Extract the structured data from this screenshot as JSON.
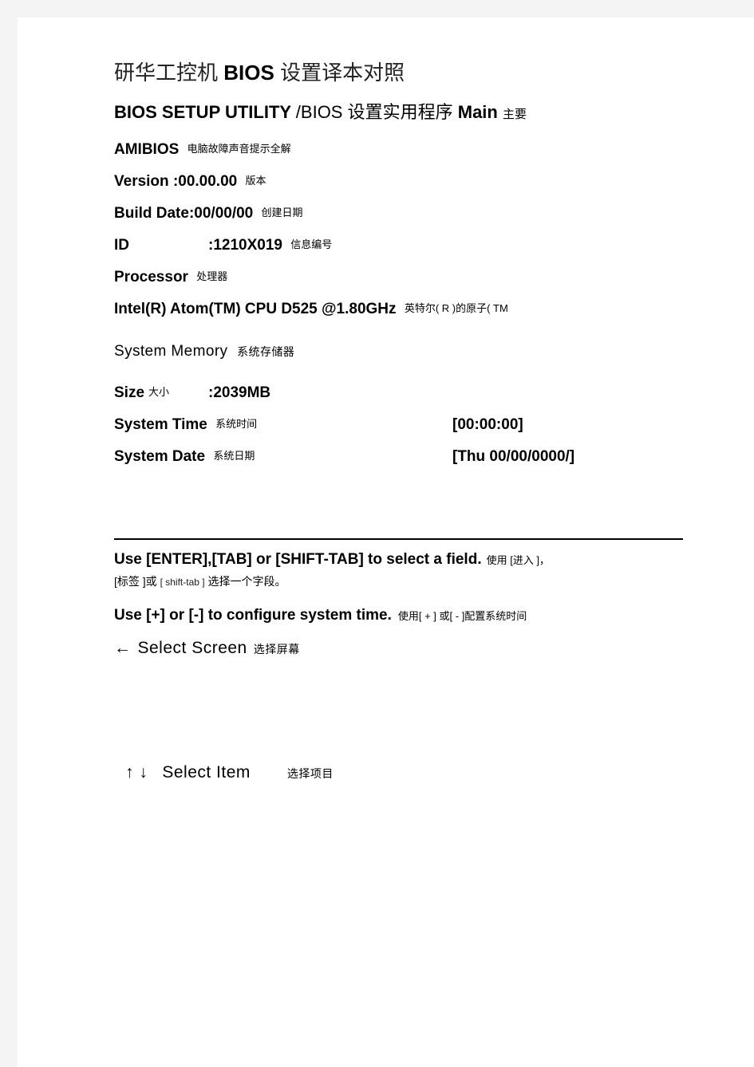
{
  "document": {
    "title_cn": "研华工控机",
    "title_en": "BIOS",
    "title_cn_tail": "设置译本对照"
  },
  "utility_header": {
    "en": "BIOS SETUP UTILITY",
    "separator": "/BIOS",
    "cn": "设置实用程序",
    "tab": "Main",
    "tab_cn": "主要"
  },
  "info": {
    "amibios": {
      "label": "AMIBIOS",
      "cn": "电脑故障声音提示全解"
    },
    "version": {
      "label": "Version",
      "value": ":00.00.00",
      "cn": "版本"
    },
    "build_date": {
      "label": "Build Date",
      "value": ":00/00/00",
      "cn": "创建日期"
    },
    "id": {
      "label": "ID",
      "value": ":1210X019",
      "cn": "信息编号"
    },
    "processor": {
      "label": "Processor",
      "cn": "处理器"
    },
    "cpu": {
      "label": "Intel(R) Atom(TM) CPU D525 @1.80GHz",
      "cn": "英特尔( R )的原子( TM"
    }
  },
  "system_memory": {
    "label": "System Memory",
    "cn": "系统存储器",
    "size": {
      "label": "Size",
      "cn": "大小",
      "value": ":2039MB"
    }
  },
  "system_time": {
    "label": "System Time",
    "cn": "系统时间",
    "value": "[00:00:00]"
  },
  "system_date": {
    "label": "System Date",
    "cn": "系统日期",
    "value": "[Thu 00/00/0000/]"
  },
  "help": {
    "line1_en": "Use [ENTER],[TAB] or [SHIFT-TAB] to select a field.",
    "line1_cn": "使用 [进入 ]，",
    "line1_cn_cont_a": "[标签 ]或",
    "line1_cn_cont_b": "[ shift-tab ]",
    "line1_cn_cont_c": "选择一个字段。",
    "line2_en": "Use [+] or [-] to configure system time.",
    "line2_cn": "使用[ + ] 或[ - ]配置系统时间"
  },
  "nav": {
    "select_screen": {
      "arrow": "←",
      "label": "Select Screen",
      "cn": "选择屏幕"
    },
    "select_item": {
      "arrow_up": "↑",
      "arrow_down": "↓",
      "label": "Select Item",
      "cn": "选择项目"
    }
  },
  "colors": {
    "page_background": "#ffffff",
    "gutter": "#f4f4f4",
    "text": "#000000",
    "rule": "#000000"
  }
}
